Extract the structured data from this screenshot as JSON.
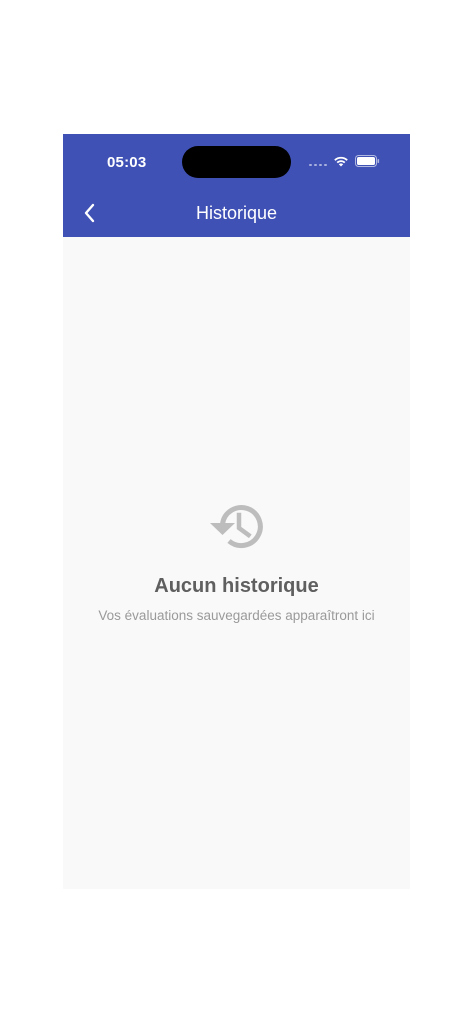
{
  "status_bar": {
    "time": "05:03"
  },
  "header": {
    "title": "Historique",
    "background": "#3f51b5",
    "back_icon": "chevron-left-icon"
  },
  "empty_state": {
    "icon": "history-icon",
    "title": "Aucun historique",
    "subtitle": "Vos évaluations sauvegardées apparaîtront ici"
  }
}
